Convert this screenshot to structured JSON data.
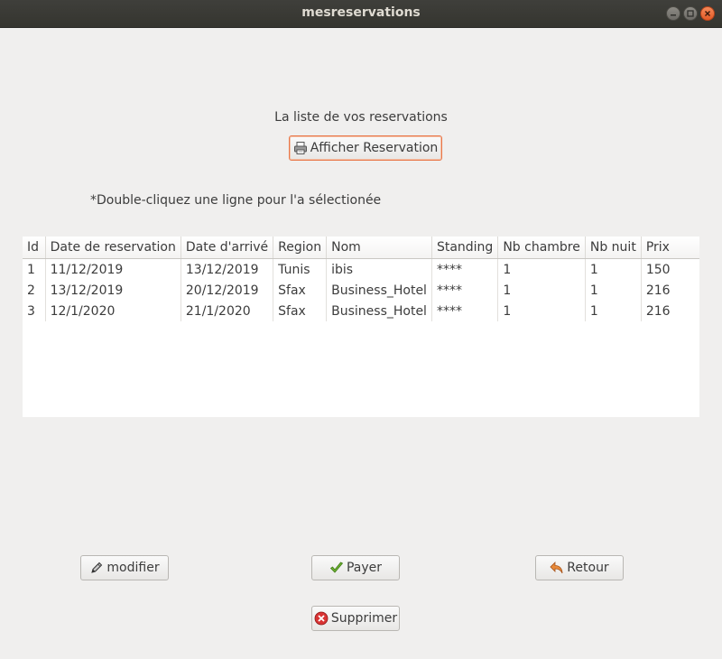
{
  "window": {
    "title": "mesreservations"
  },
  "header": {
    "list_title": "La liste de vos reservations",
    "show_button_label": "Afficher Reservation",
    "hint": "*Double-cliquez une ligne pour l'a sélectionée"
  },
  "table": {
    "columns": [
      "Id",
      "Date de reservation",
      "Date d'arrivé",
      "Region",
      "Nom",
      "Standing",
      "Nb chambre",
      "Nb nuit",
      "Prix"
    ],
    "rows": [
      [
        "1",
        "11/12/2019",
        "13/12/2019",
        "Tunis",
        "ibis",
        "****",
        "1",
        "1",
        "150"
      ],
      [
        "2",
        "13/12/2019",
        "20/12/2019",
        "Sfax",
        "Business_Hotel",
        "****",
        "1",
        "1",
        "216"
      ],
      [
        "3",
        "12/1/2020",
        "21/1/2020",
        "Sfax",
        "Business_Hotel",
        "****",
        "1",
        "1",
        "216"
      ]
    ]
  },
  "actions": {
    "modify_label": "modifier",
    "pay_label": "Payer",
    "back_label": "Retour",
    "delete_label": "Supprimer"
  },
  "icons": {
    "printer": "printer-icon",
    "pencil": "pencil-icon",
    "check": "checkmark-icon",
    "undo": "undo-arrow-icon",
    "delete": "delete-icon"
  },
  "colors": {
    "focus_border": "#e9784a",
    "check_green": "#5aa02c",
    "delete_red": "#d42424",
    "undo_orange": "#e07a2a"
  }
}
